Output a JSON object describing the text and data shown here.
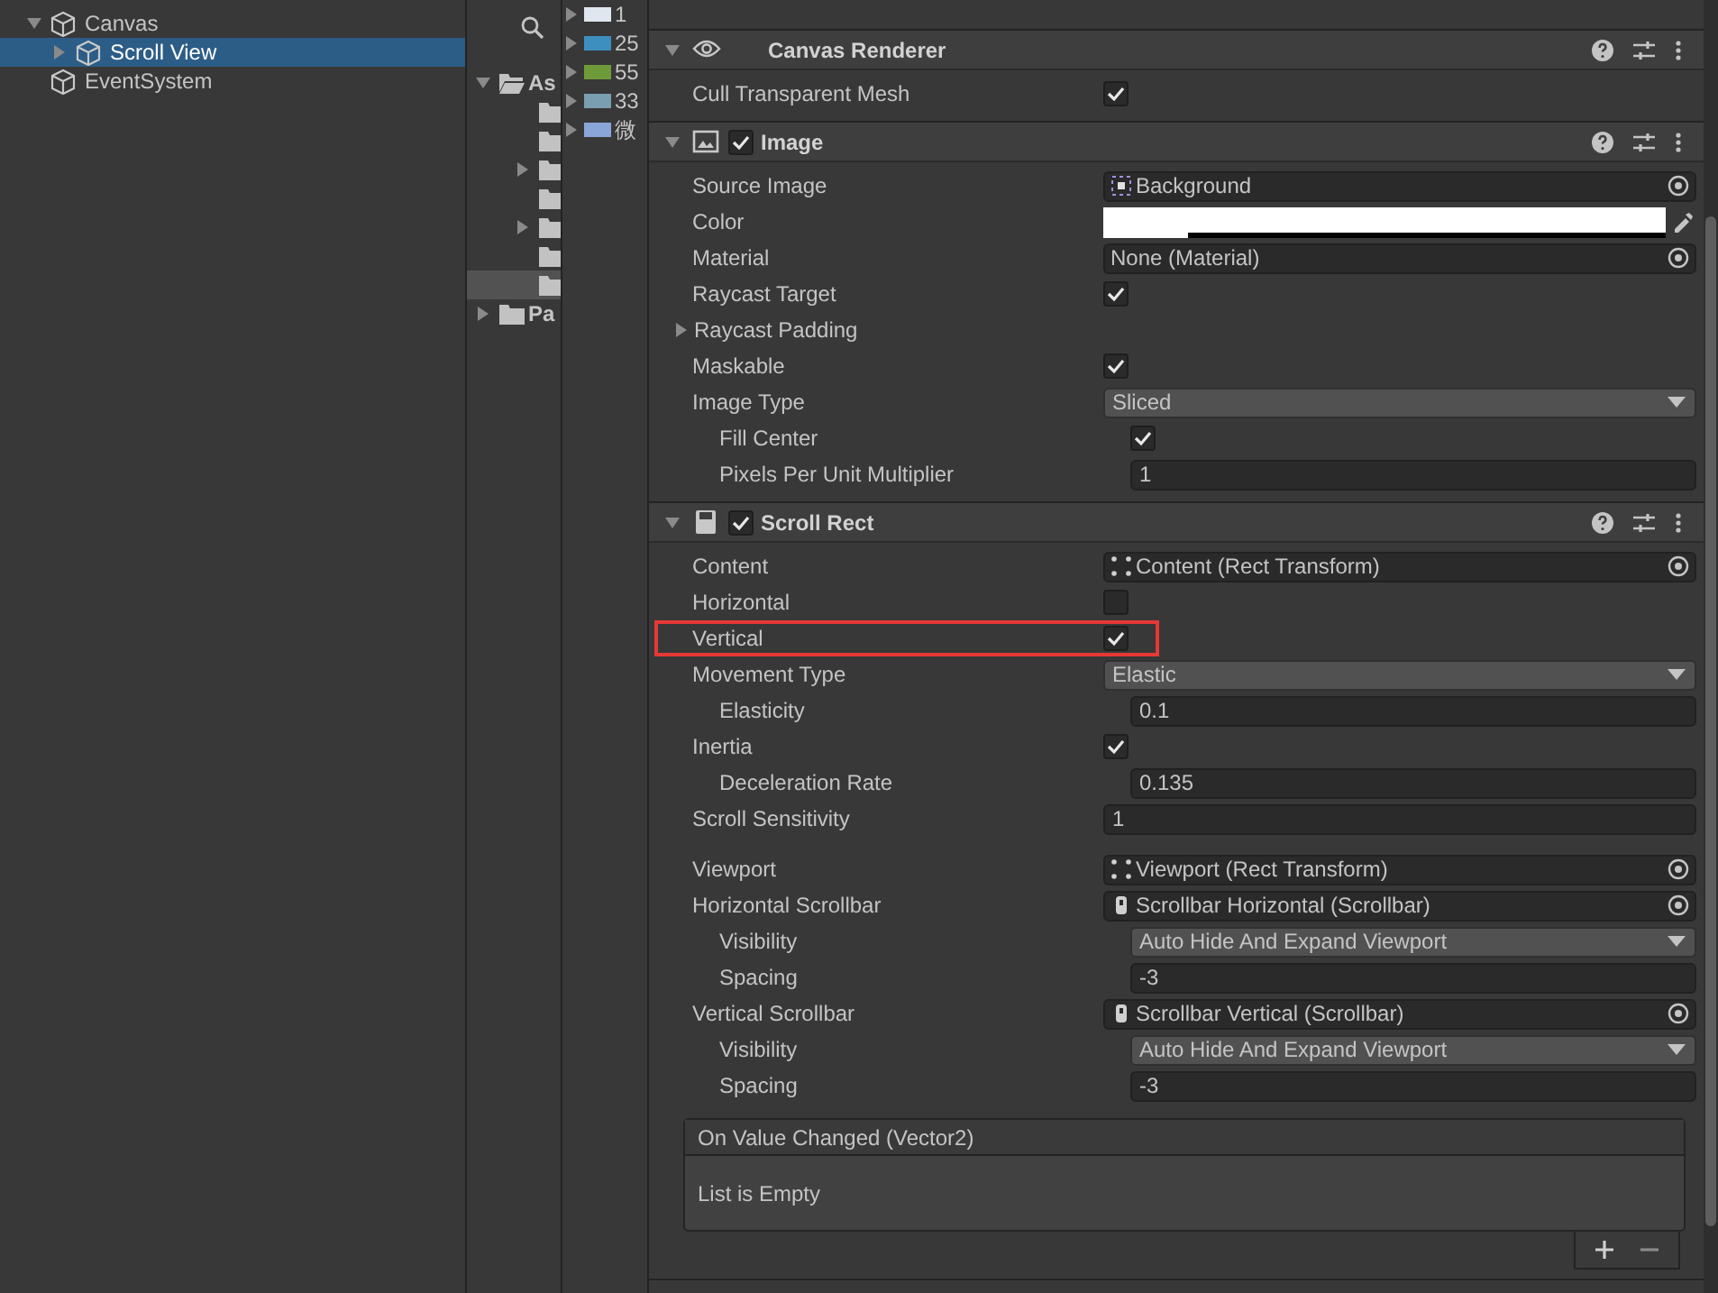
{
  "hierarchy": {
    "items": [
      {
        "label": "Canvas",
        "expanded": true,
        "selected": false,
        "children": [
          {
            "label": "Scroll View",
            "expanded": false,
            "selected": true
          }
        ]
      },
      {
        "label": "EventSystem",
        "selected": false
      }
    ]
  },
  "project": {
    "folders": [
      {
        "label": "As",
        "expanded": true,
        "selected": false,
        "children": [
          {
            "selected": false
          },
          {
            "selected": false
          },
          {
            "selected": false,
            "expanded": false
          },
          {
            "selected": false
          },
          {
            "selected": false,
            "expanded": false
          },
          {
            "selected": false
          },
          {
            "selected": true
          }
        ]
      },
      {
        "label": "Pa",
        "expanded": false,
        "selected": false
      }
    ],
    "assets": [
      {
        "label": "1"
      },
      {
        "label": "25"
      },
      {
        "label": "55"
      },
      {
        "label": "33"
      },
      {
        "label": "微"
      }
    ]
  },
  "inspector": {
    "components": [
      {
        "title": "Canvas Renderer",
        "properties": [
          {
            "kind": "checkbox",
            "label": "Cull Transparent Mesh",
            "checked": true
          }
        ]
      },
      {
        "title": "Image",
        "enabled": true,
        "properties": [
          {
            "kind": "object",
            "label": "Source Image",
            "value": "Background"
          },
          {
            "kind": "color",
            "label": "Color",
            "color": "#ffffff",
            "level": 0.15
          },
          {
            "kind": "object",
            "label": "Material",
            "value": "None (Material)"
          },
          {
            "kind": "checkbox",
            "label": "Raycast Target",
            "checked": true
          },
          {
            "kind": "foldout",
            "label": "Raycast Padding",
            "expanded": false
          },
          {
            "kind": "checkbox",
            "label": "Maskable",
            "checked": true
          },
          {
            "kind": "dropdown",
            "label": "Image Type",
            "value": "Sliced",
            "children": [
              {
                "kind": "checkbox",
                "label": "Fill Center",
                "checked": true
              },
              {
                "kind": "number",
                "label": "Pixels Per Unit Multiplier",
                "value": "1"
              }
            ]
          }
        ]
      },
      {
        "title": "Scroll Rect",
        "enabled": true,
        "properties": [
          {
            "kind": "object",
            "label": "Content",
            "value": "Content (Rect Transform)"
          },
          {
            "kind": "checkbox",
            "label": "Horizontal",
            "checked": false
          },
          {
            "kind": "checkbox",
            "label": "Vertical",
            "checked": true,
            "highlighted": true
          },
          {
            "kind": "dropdown",
            "label": "Movement Type",
            "value": "Elastic",
            "children": [
              {
                "kind": "number",
                "label": "Elasticity",
                "value": "0.1"
              }
            ]
          },
          {
            "kind": "checkbox",
            "label": "Inertia",
            "checked": true,
            "children": [
              {
                "kind": "number",
                "label": "Deceleration Rate",
                "value": "0.135"
              }
            ]
          },
          {
            "kind": "number",
            "label": "Scroll Sensitivity",
            "value": "1"
          },
          {
            "kind": "space"
          },
          {
            "kind": "object",
            "label": "Viewport",
            "value": "Viewport (Rect Transform)"
          },
          {
            "kind": "object",
            "label": "Horizontal Scrollbar",
            "value": "Scrollbar Horizontal (Scrollbar)",
            "children": [
              {
                "kind": "dropdown",
                "label": "Visibility",
                "value": "Auto Hide And Expand Viewport"
              },
              {
                "kind": "number",
                "label": "Spacing",
                "value": "-3"
              }
            ]
          },
          {
            "kind": "object",
            "label": "Vertical Scrollbar",
            "value": "Scrollbar Vertical (Scrollbar)",
            "children": [
              {
                "kind": "dropdown",
                "label": "Visibility",
                "value": "Auto Hide And Expand Viewport"
              },
              {
                "kind": "number",
                "label": "Spacing",
                "value": "-3"
              }
            ]
          },
          {
            "kind": "event",
            "label": "On Value Changed (Vector2)",
            "value": "List is Empty"
          }
        ]
      }
    ]
  }
}
